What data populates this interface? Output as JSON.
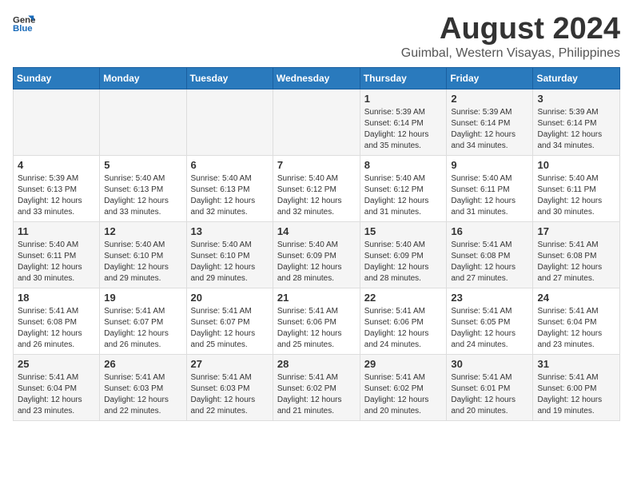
{
  "header": {
    "logo_general": "General",
    "logo_blue": "Blue",
    "title": "August 2024",
    "subtitle": "Guimbal, Western Visayas, Philippines"
  },
  "weekdays": [
    "Sunday",
    "Monday",
    "Tuesday",
    "Wednesday",
    "Thursday",
    "Friday",
    "Saturday"
  ],
  "weeks": [
    [
      {
        "day": "",
        "info": ""
      },
      {
        "day": "",
        "info": ""
      },
      {
        "day": "",
        "info": ""
      },
      {
        "day": "",
        "info": ""
      },
      {
        "day": "1",
        "info": "Sunrise: 5:39 AM\nSunset: 6:14 PM\nDaylight: 12 hours\nand 35 minutes."
      },
      {
        "day": "2",
        "info": "Sunrise: 5:39 AM\nSunset: 6:14 PM\nDaylight: 12 hours\nand 34 minutes."
      },
      {
        "day": "3",
        "info": "Sunrise: 5:39 AM\nSunset: 6:14 PM\nDaylight: 12 hours\nand 34 minutes."
      }
    ],
    [
      {
        "day": "4",
        "info": "Sunrise: 5:39 AM\nSunset: 6:13 PM\nDaylight: 12 hours\nand 33 minutes."
      },
      {
        "day": "5",
        "info": "Sunrise: 5:40 AM\nSunset: 6:13 PM\nDaylight: 12 hours\nand 33 minutes."
      },
      {
        "day": "6",
        "info": "Sunrise: 5:40 AM\nSunset: 6:13 PM\nDaylight: 12 hours\nand 32 minutes."
      },
      {
        "day": "7",
        "info": "Sunrise: 5:40 AM\nSunset: 6:12 PM\nDaylight: 12 hours\nand 32 minutes."
      },
      {
        "day": "8",
        "info": "Sunrise: 5:40 AM\nSunset: 6:12 PM\nDaylight: 12 hours\nand 31 minutes."
      },
      {
        "day": "9",
        "info": "Sunrise: 5:40 AM\nSunset: 6:11 PM\nDaylight: 12 hours\nand 31 minutes."
      },
      {
        "day": "10",
        "info": "Sunrise: 5:40 AM\nSunset: 6:11 PM\nDaylight: 12 hours\nand 30 minutes."
      }
    ],
    [
      {
        "day": "11",
        "info": "Sunrise: 5:40 AM\nSunset: 6:11 PM\nDaylight: 12 hours\nand 30 minutes."
      },
      {
        "day": "12",
        "info": "Sunrise: 5:40 AM\nSunset: 6:10 PM\nDaylight: 12 hours\nand 29 minutes."
      },
      {
        "day": "13",
        "info": "Sunrise: 5:40 AM\nSunset: 6:10 PM\nDaylight: 12 hours\nand 29 minutes."
      },
      {
        "day": "14",
        "info": "Sunrise: 5:40 AM\nSunset: 6:09 PM\nDaylight: 12 hours\nand 28 minutes."
      },
      {
        "day": "15",
        "info": "Sunrise: 5:40 AM\nSunset: 6:09 PM\nDaylight: 12 hours\nand 28 minutes."
      },
      {
        "day": "16",
        "info": "Sunrise: 5:41 AM\nSunset: 6:08 PM\nDaylight: 12 hours\nand 27 minutes."
      },
      {
        "day": "17",
        "info": "Sunrise: 5:41 AM\nSunset: 6:08 PM\nDaylight: 12 hours\nand 27 minutes."
      }
    ],
    [
      {
        "day": "18",
        "info": "Sunrise: 5:41 AM\nSunset: 6:08 PM\nDaylight: 12 hours\nand 26 minutes."
      },
      {
        "day": "19",
        "info": "Sunrise: 5:41 AM\nSunset: 6:07 PM\nDaylight: 12 hours\nand 26 minutes."
      },
      {
        "day": "20",
        "info": "Sunrise: 5:41 AM\nSunset: 6:07 PM\nDaylight: 12 hours\nand 25 minutes."
      },
      {
        "day": "21",
        "info": "Sunrise: 5:41 AM\nSunset: 6:06 PM\nDaylight: 12 hours\nand 25 minutes."
      },
      {
        "day": "22",
        "info": "Sunrise: 5:41 AM\nSunset: 6:06 PM\nDaylight: 12 hours\nand 24 minutes."
      },
      {
        "day": "23",
        "info": "Sunrise: 5:41 AM\nSunset: 6:05 PM\nDaylight: 12 hours\nand 24 minutes."
      },
      {
        "day": "24",
        "info": "Sunrise: 5:41 AM\nSunset: 6:04 PM\nDaylight: 12 hours\nand 23 minutes."
      }
    ],
    [
      {
        "day": "25",
        "info": "Sunrise: 5:41 AM\nSunset: 6:04 PM\nDaylight: 12 hours\nand 23 minutes."
      },
      {
        "day": "26",
        "info": "Sunrise: 5:41 AM\nSunset: 6:03 PM\nDaylight: 12 hours\nand 22 minutes."
      },
      {
        "day": "27",
        "info": "Sunrise: 5:41 AM\nSunset: 6:03 PM\nDaylight: 12 hours\nand 22 minutes."
      },
      {
        "day": "28",
        "info": "Sunrise: 5:41 AM\nSunset: 6:02 PM\nDaylight: 12 hours\nand 21 minutes."
      },
      {
        "day": "29",
        "info": "Sunrise: 5:41 AM\nSunset: 6:02 PM\nDaylight: 12 hours\nand 20 minutes."
      },
      {
        "day": "30",
        "info": "Sunrise: 5:41 AM\nSunset: 6:01 PM\nDaylight: 12 hours\nand 20 minutes."
      },
      {
        "day": "31",
        "info": "Sunrise: 5:41 AM\nSunset: 6:00 PM\nDaylight: 12 hours\nand 19 minutes."
      }
    ]
  ]
}
